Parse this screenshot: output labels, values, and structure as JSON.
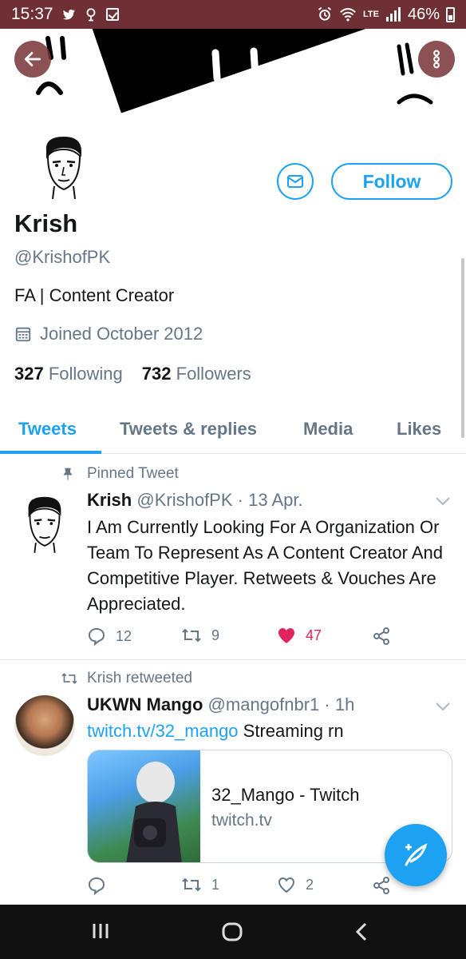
{
  "status_bar": {
    "time": "15:37",
    "network": "LTE",
    "battery": "46%"
  },
  "profile": {
    "name": "Krish",
    "handle": "@KrishofPK",
    "bio": "FA | Content Creator",
    "joined": "Joined October 2012",
    "following_count": "327",
    "following_label": "Following",
    "followers_count": "732",
    "followers_label": "Followers",
    "follow_label": "Follow"
  },
  "tabs": [
    {
      "label": "Tweets",
      "active": true
    },
    {
      "label": "Tweets & replies",
      "active": false
    },
    {
      "label": "Media",
      "active": false
    },
    {
      "label": "Likes",
      "active": false
    }
  ],
  "tweets": [
    {
      "context": "Pinned Tweet",
      "name": "Krish",
      "handle": "@KrishofPK",
      "time": "13 Apr.",
      "text": "I Am Currently Looking For A Organization Or Team To Represent As A Content Creator And Competitive Player. Retweets & Vouches Are Appreciated.",
      "replies": "12",
      "retweets": "9",
      "likes": "47",
      "liked": true
    },
    {
      "context": "Krish retweeted",
      "name": "UKWN Mango",
      "handle": "@mangofnbr1",
      "time": "1h",
      "link": "twitch.tv/32_mango",
      "text": "Streaming rn",
      "card_title": "32_Mango - Twitch",
      "card_domain": "twitch.tv",
      "replies": "",
      "retweets": "1",
      "likes": "2",
      "liked": false
    }
  ],
  "colors": {
    "accent": "#1da1f2",
    "like": "#e0245e",
    "status_bar": "#6e2f35"
  }
}
